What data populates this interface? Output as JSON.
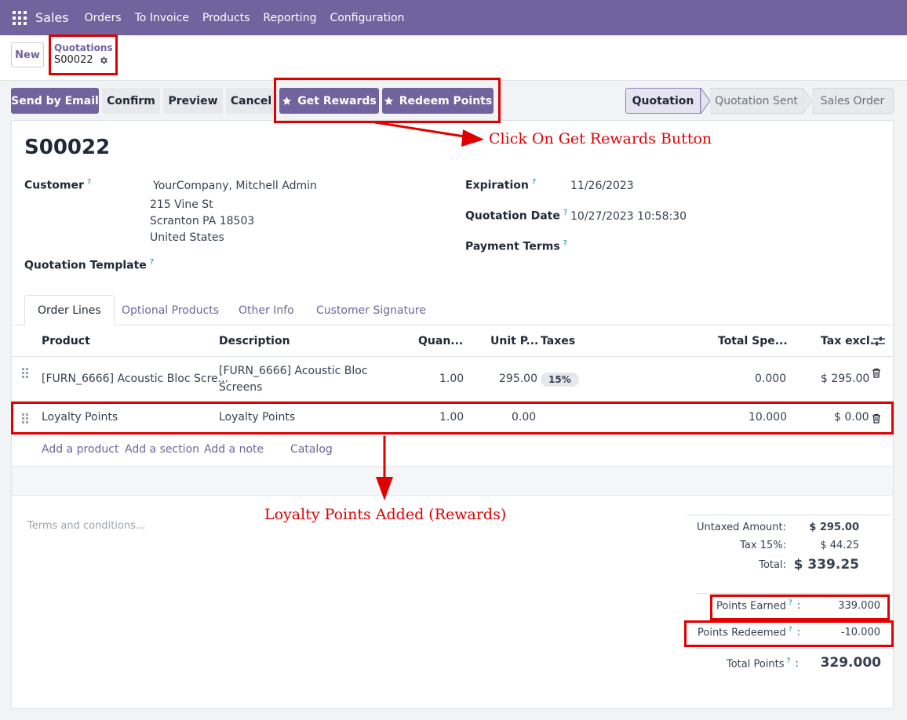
{
  "navbar": {
    "app": "Sales",
    "menu": [
      "Orders",
      "To Invoice",
      "Products",
      "Reporting",
      "Configuration"
    ]
  },
  "control": {
    "new_label": "New",
    "breadcrumb_parent": "Quotations",
    "breadcrumb_current": "S00022"
  },
  "actions": {
    "send_email": "Send by Email",
    "confirm": "Confirm",
    "preview": "Preview",
    "cancel": "Cancel",
    "get_rewards": "Get Rewards",
    "redeem_points": "Redeem Points"
  },
  "status": {
    "stages": [
      "Quotation",
      "Quotation Sent",
      "Sales Order"
    ],
    "active": "Quotation"
  },
  "form": {
    "name": "S00022",
    "customer_label": "Customer",
    "customer_name": "YourCompany, Mitchell Admin",
    "customer_street": "215 Vine St",
    "customer_city": "Scranton PA 18503",
    "customer_country": "United States",
    "template_label": "Quotation Template",
    "expiration_label": "Expiration",
    "expiration_value": "11/26/2023",
    "qdate_label": "Quotation Date",
    "qdate_value": "10/27/2023 10:58:30",
    "payment_label": "Payment Terms",
    "help_mark": "?"
  },
  "tabs": [
    "Order Lines",
    "Optional Products",
    "Other Info",
    "Customer Signature"
  ],
  "table": {
    "headers": {
      "product": "Product",
      "description": "Description",
      "quantity": "Quan...",
      "unit_price": "Unit P...",
      "taxes": "Taxes",
      "total_spent": "Total Spe...",
      "tax_excl": "Tax excl."
    },
    "rows": [
      {
        "product": "[FURN_6666] Acoustic Bloc Scre...",
        "description_1": "[FURN_6666] Acoustic Bloc",
        "description_2": "Screens",
        "quantity": "1.00",
        "unit_price": "295.00",
        "tax": "15%",
        "total_spent": "0.000",
        "subtotal": "$ 295.00"
      },
      {
        "product": "Loyalty Points",
        "description_1": "Loyalty Points",
        "quantity": "1.00",
        "unit_price": "0.00",
        "total_spent": "10.000",
        "subtotal": "$ 0.00"
      }
    ],
    "add_links": [
      "Add a product",
      "Add a section",
      "Add a note",
      "Catalog"
    ]
  },
  "terms_placeholder": "Terms and conditions...",
  "totals": {
    "untaxed_label": "Untaxed Amount:",
    "untaxed_value": "$ 295.00",
    "tax_label": "Tax 15%:",
    "tax_value": "$ 44.25",
    "total_label": "Total:",
    "total_value": "$ 339.25",
    "earned_label": "Points Earned",
    "earned_value": "339.000",
    "redeemed_label": "Points Redeemed",
    "redeemed_value": "-10.000",
    "total_points_label": "Total Points",
    "total_points_value": "329.000",
    "colon": ":"
  },
  "annotations": {
    "click_note": "Click On Get Rewards Button",
    "added_note": "Loyalty Points Added (Rewards)",
    "color": "#e00000"
  },
  "colors": {
    "brand": "#71639e",
    "help": "#008f8c"
  }
}
